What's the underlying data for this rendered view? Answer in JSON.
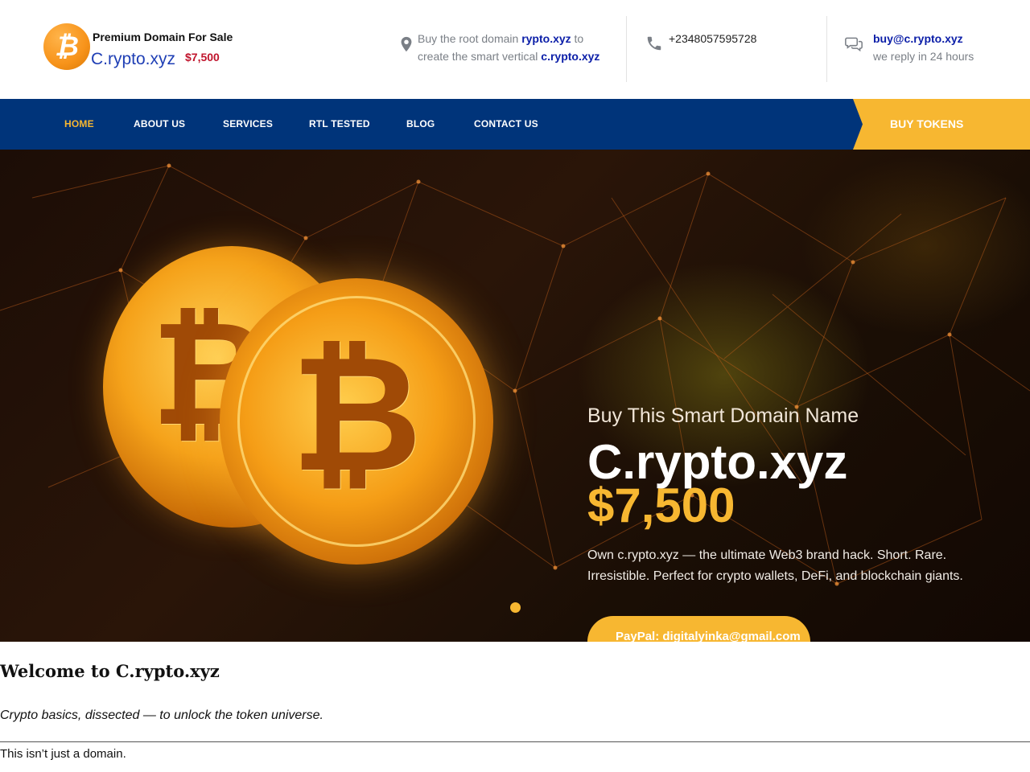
{
  "header": {
    "logo": {
      "tagline": "Premium Domain For Sale",
      "name": "C.rypto.xyz",
      "price": "$7,500",
      "coin_symbol": "₿"
    },
    "location": {
      "icon": "map-pin-icon",
      "pre": "Buy the root domain",
      "root": "rypto.xyz",
      "mid": "to",
      "line2": "create the smart vertical",
      "domain": "c.rypto.xyz"
    },
    "phone": {
      "icon": "phone-icon",
      "number": "+2348057595728"
    },
    "email": {
      "icon": "chat-bubbles-icon",
      "address": "buy@c.rypto.xyz",
      "note": "we reply in 24 hours"
    }
  },
  "nav": {
    "items": [
      {
        "label": "HOME",
        "active": true
      },
      {
        "label": "ABOUT US"
      },
      {
        "label": "SERVICES"
      },
      {
        "label": "RTL TESTED"
      },
      {
        "label": "BLOG"
      },
      {
        "label": "CONTACT US"
      }
    ],
    "cta": "BUY TOKENS"
  },
  "hero": {
    "subtitle": "Buy This Smart Domain Name",
    "title": "C.rypto.xyz",
    "price": "$7,500",
    "description": "Own c.rypto.xyz — the ultimate Web3 brand hack. Short. Rare. Irresistible. Perfect for crypto wallets, DeFi, and blockchain giants.",
    "button": "PayPal: digitalyinka@gmail.com",
    "coin_symbol": "₿"
  },
  "content": {
    "heading": "Welcome to C.rypto.xyz",
    "tagline": "Crypto basics, dissected — to unlock the token universe.",
    "first_line": "This isn’t just a domain."
  },
  "colors": {
    "nav_bg": "#00347a",
    "accent": "#f7b731",
    "link": "#0b1ea8",
    "price_red": "#c0142c"
  }
}
